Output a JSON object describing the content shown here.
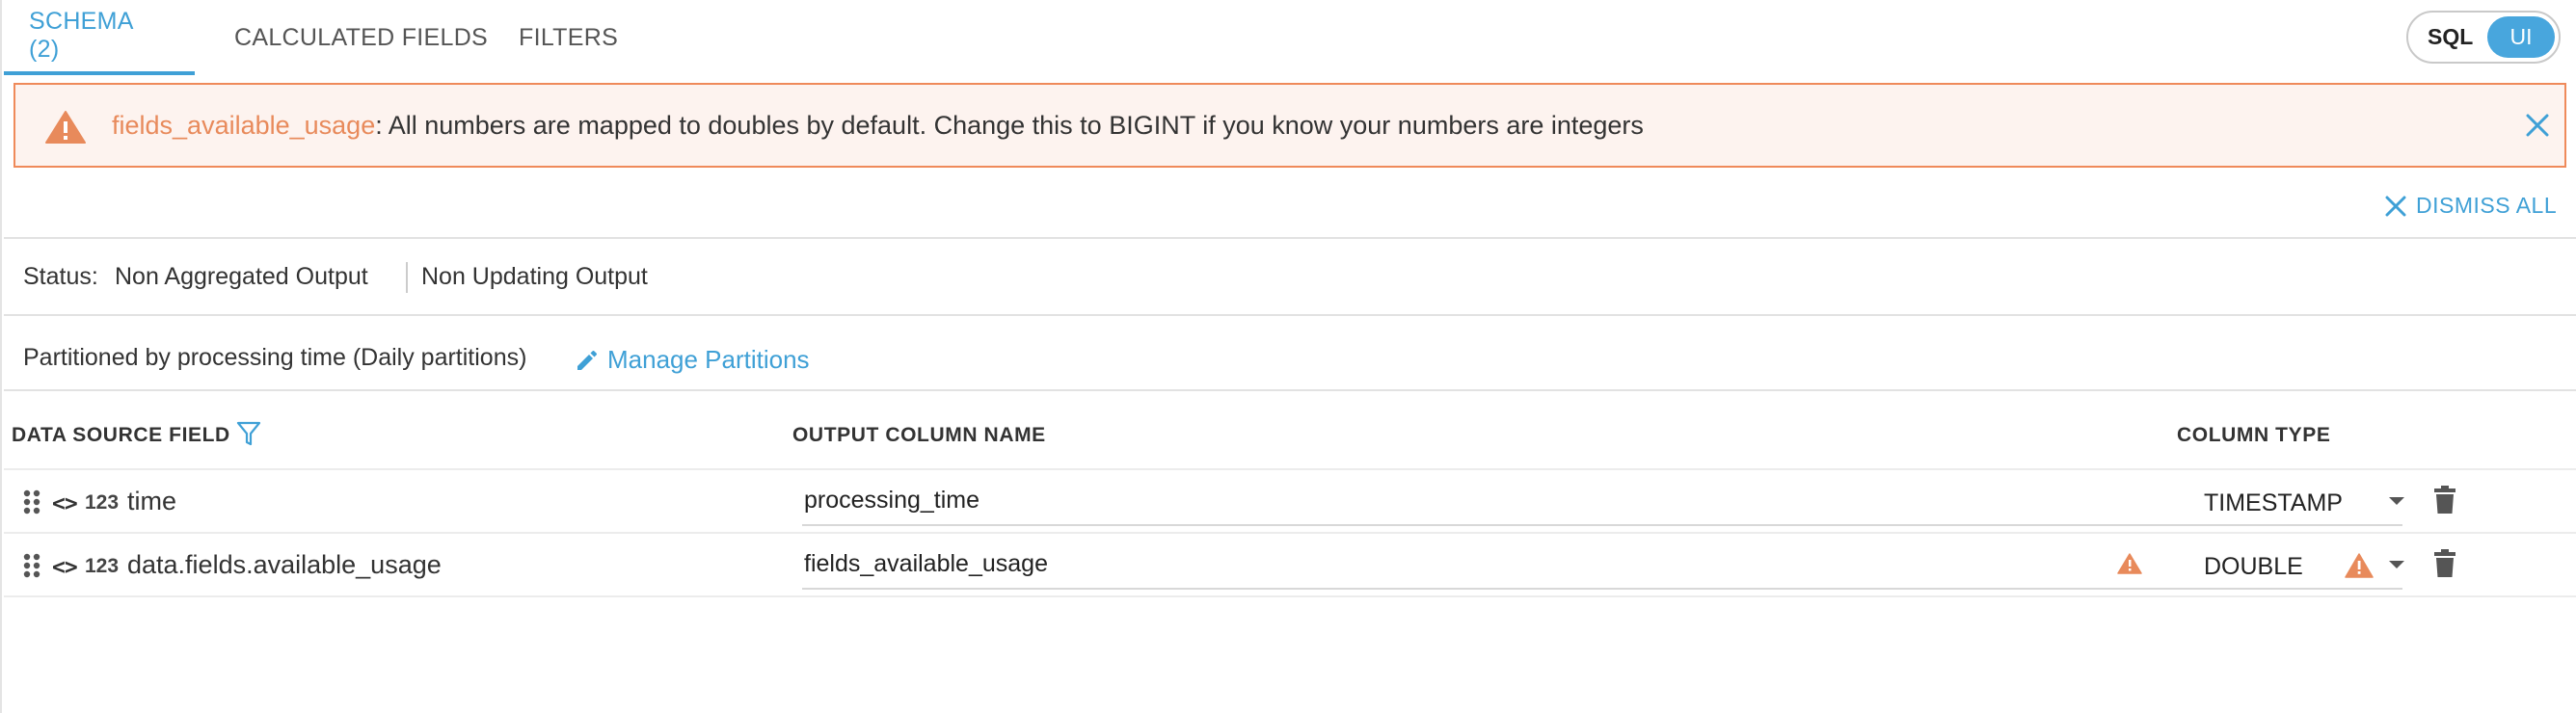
{
  "tabs": [
    {
      "label": "SCHEMA (2)",
      "active": true
    },
    {
      "label": "CALCULATED FIELDS",
      "active": false
    },
    {
      "label": "FILTERS",
      "active": false
    }
  ],
  "mode_toggle": {
    "sql_label": "SQL",
    "ui_label": "UI",
    "selected": "UI"
  },
  "alert": {
    "field": "fields_available_usage",
    "message": ": All numbers are mapped to doubles by default. Change this to BIGINT if you know your numbers are integers",
    "icon": "warning-icon",
    "close_icon": "close-icon"
  },
  "dismiss_all_label": "DISMISS ALL",
  "status": {
    "label": "Status:",
    "aggregation": "Non Aggregated Output",
    "updating": "Non Updating Output"
  },
  "partition": {
    "text": "Partitioned by processing time (Daily partitions)",
    "manage_label": "Manage Partitions"
  },
  "table": {
    "headers": {
      "source": "DATA SOURCE FIELD",
      "output": "OUTPUT COLUMN NAME",
      "type": "COLUMN TYPE"
    },
    "rows": [
      {
        "code_icon": "<>",
        "type_icon": "123",
        "source": "time",
        "output": "processing_time",
        "column_type": "TIMESTAMP",
        "warning": false
      },
      {
        "code_icon": "<>",
        "type_icon": "123",
        "source": "data.fields.available_usage",
        "output": "fields_available_usage",
        "column_type": "DOUBLE",
        "warning": true
      }
    ]
  },
  "colors": {
    "accent": "#3fa0d6",
    "warning": "#e88a5b",
    "alert_bg": "#fdf3ef",
    "alert_border": "#ef8a5a"
  }
}
